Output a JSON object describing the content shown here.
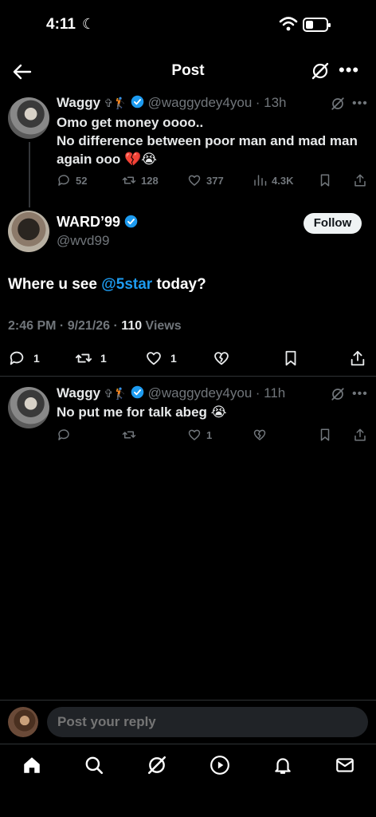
{
  "status_bar": {
    "time": "4:11"
  },
  "header": {
    "title": "Post"
  },
  "parent_tweet": {
    "name": "Waggy",
    "name_emoji": "✞🏌️",
    "handle": "@waggydey4you",
    "time": "· 13h",
    "text": "Omo get money oooo..\nNo difference between poor man and mad man again ooo 💔😭",
    "replies": "52",
    "retweets": "128",
    "likes": "377",
    "views": "4.3K"
  },
  "main_tweet": {
    "name": "WARD’99",
    "handle": "@wvd99",
    "follow_label": "Follow",
    "text_before": "Where u see ",
    "mention": "@5star",
    "text_after": " today?",
    "timestamp": "2:46 PM · 9/21/26 · ",
    "views_count": "110",
    "views_label": " Views",
    "replies": "1",
    "retweets": "1",
    "likes": "1"
  },
  "reply_tweet": {
    "name": "Waggy",
    "name_emoji": "✞🏌️",
    "handle": "@waggydey4you",
    "time": "· 11h",
    "text": "No put me for talk abeg 😭",
    "likes": "1"
  },
  "reply_bar": {
    "placeholder": "Post your reply"
  },
  "colors": {
    "accent": "#1d9bf0",
    "background": "#000000",
    "muted": "#71767b"
  },
  "tabbar": {
    "items": [
      "home-icon",
      "search-icon",
      "grok-icon",
      "play-icon",
      "bell-icon",
      "mail-icon"
    ]
  }
}
